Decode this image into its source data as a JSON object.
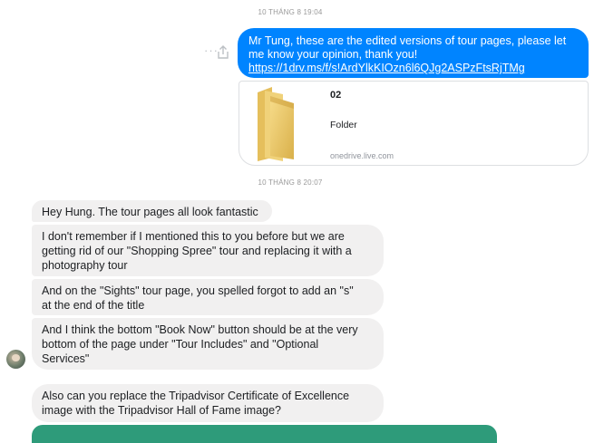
{
  "timestamps": {
    "first": "10 THÁNG 8 19:04",
    "second": "10 THÁNG 8 20:07"
  },
  "outgoing": {
    "text_line1": "Mr Tung, these are the edited versions of tour pages, please let",
    "text_line2": "me know your opinion, thank you!",
    "link": "https://1drv.ms/f/s!ArdYlkKIOzn6l6QJg2ASPzFtsRjTMg",
    "bubble_color": "#0084ff"
  },
  "attachment": {
    "title": "02",
    "subtitle": "Folder",
    "domain": "onedrive.live.com",
    "icon": "folder-icon"
  },
  "incoming": [
    {
      "lines": [
        "Hey Hung. The tour pages all look fantastic"
      ]
    },
    {
      "lines": [
        "I don't remember if I mentioned this to you before but we are",
        "getting rid of our \"Shopping Spree\" tour and replacing it with a",
        "photography tour"
      ]
    },
    {
      "lines": [
        "And on the \"Sights\" tour page, you spelled forgot to add an \"s\"",
        "at the end of the title"
      ]
    },
    {
      "lines": [
        "And I think the bottom \"Book Now\" button should be at the very",
        "bottom of the page under \"Tour Includes\" and \"Optional",
        "Services\""
      ]
    },
    {
      "lines": [
        "Also can you replace the Tripadvisor Certificate of Excellence",
        "image with the Tripadvisor Hall of Fame image?"
      ]
    }
  ],
  "colors": {
    "incoming_bubble": "#f1f0f0",
    "green_attachment": "#2e9b7a"
  }
}
